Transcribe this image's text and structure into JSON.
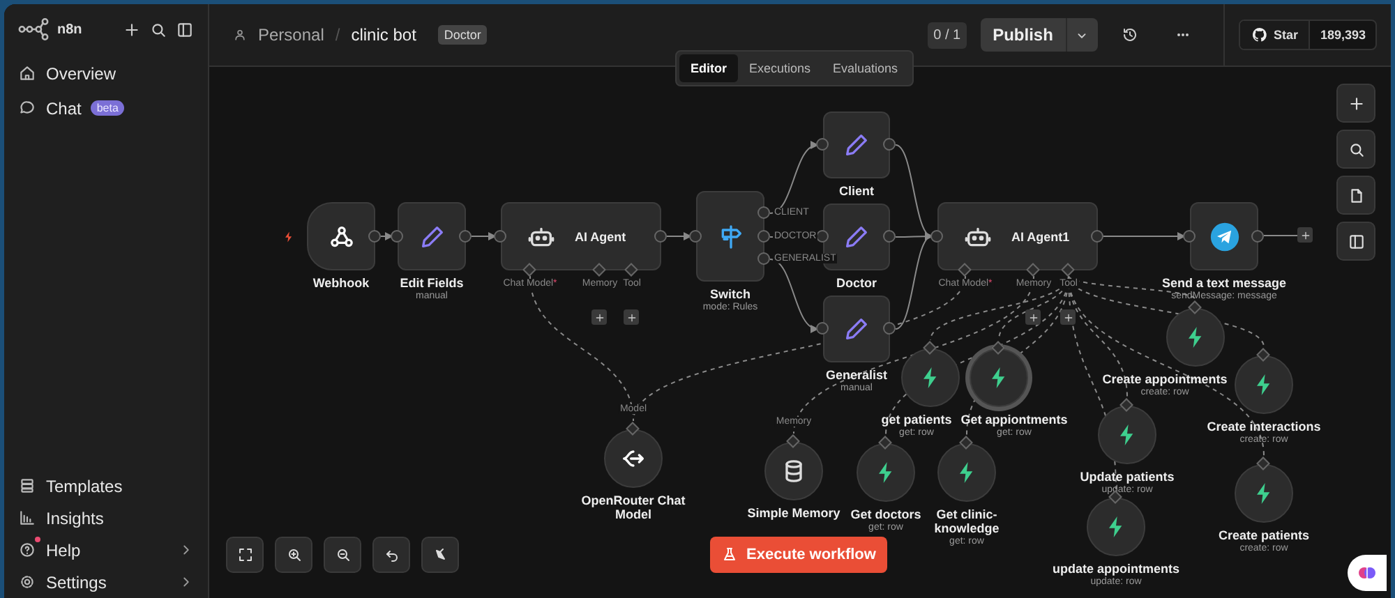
{
  "sidebar": {
    "logo": "n8n",
    "items": [
      {
        "label": "Overview"
      },
      {
        "label": "Chat",
        "badge": "beta"
      }
    ],
    "bottom_items": [
      {
        "label": "Templates",
        "notification": false,
        "expandable": false
      },
      {
        "label": "Insights",
        "notification": false,
        "expandable": false
      },
      {
        "label": "Help",
        "notification": true,
        "expandable": true
      },
      {
        "label": "Settings",
        "notification": false,
        "expandable": true
      }
    ]
  },
  "header": {
    "project": "Personal",
    "separator": "/",
    "workflow": "clinic bot",
    "tag": "Doctor",
    "version": "0 / 1",
    "publish": "Publish",
    "github": {
      "label": "Star",
      "count": "189,393"
    }
  },
  "tabs": [
    {
      "label": "Editor",
      "selected": true
    },
    {
      "label": "Executions",
      "selected": false
    },
    {
      "label": "Evaluations",
      "selected": false
    }
  ],
  "canvas": {
    "nodes": [
      {
        "kind": "webhook",
        "title": "Webhook",
        "trigger": true,
        "selected": false
      },
      {
        "kind": "set",
        "title": "Edit Fields",
        "subtitle": "manual",
        "selected": false
      },
      {
        "kind": "agent",
        "title": "AI Agent",
        "ports": [
          {
            "label": "Chat Model",
            "required_mark": "*"
          },
          {
            "label": "Memory"
          },
          {
            "label": "Tool"
          }
        ],
        "selected": false
      },
      {
        "kind": "switch",
        "title": "Switch",
        "subtitle": "mode: Rules",
        "outputs": [
          "CLIENT",
          "DOCTOR",
          "GENERALIST"
        ],
        "selected": false
      },
      {
        "kind": "set",
        "title": "Client",
        "selected": false
      },
      {
        "kind": "set",
        "title": "Doctor",
        "selected": false
      },
      {
        "kind": "set",
        "title": "Generalist",
        "subtitle": "manual",
        "selected": false
      },
      {
        "kind": "agent",
        "title": "AI Agent1",
        "ports": [
          {
            "label": "Chat Model",
            "required_mark": "*"
          },
          {
            "label": "Memory"
          },
          {
            "label": "Tool"
          }
        ],
        "selected": false
      },
      {
        "kind": "telegram",
        "title": "Send a text message",
        "subtitle": "sendMessage: message",
        "selected": false
      },
      {
        "kind": "model",
        "title": "OpenRouter Chat Model",
        "input_label": "Model",
        "selected": false
      },
      {
        "kind": "memory",
        "title": "Simple Memory",
        "input_label": "Memory",
        "selected": false
      },
      {
        "kind": "tool",
        "title": "get patients",
        "subtitle": "get: row",
        "selected": false
      },
      {
        "kind": "tool",
        "title": "Get appiontments",
        "subtitle": "get: row",
        "selected": true
      },
      {
        "kind": "tool",
        "title": "Get doctors",
        "subtitle": "get: row",
        "selected": false
      },
      {
        "kind": "tool",
        "title": "Get clinic-knowledge",
        "subtitle": "get: row",
        "selected": false
      },
      {
        "kind": "tool",
        "title": "Create appointments",
        "subtitle": "create: row",
        "selected": false
      },
      {
        "kind": "tool",
        "title": "Create interactions",
        "subtitle": "create: row",
        "selected": false
      },
      {
        "kind": "tool",
        "title": "Update patients",
        "subtitle": "update: row",
        "selected": false
      },
      {
        "kind": "tool",
        "title": "update appointments",
        "subtitle": "update: row",
        "selected": false
      },
      {
        "kind": "tool",
        "title": "Create patients",
        "subtitle": "create: row",
        "selected": false
      }
    ],
    "execute_button": "Execute workflow"
  }
}
